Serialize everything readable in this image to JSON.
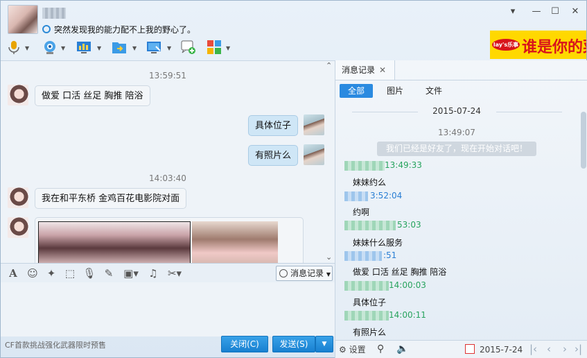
{
  "header": {
    "signature": "突然发现我的能力配不上我的野心了。",
    "window_controls": [
      "▾",
      "—",
      "☐",
      "✕"
    ],
    "ad": {
      "logo": "lay's乐事",
      "text": "谁是你的菜"
    },
    "toolbar": [
      "microphone-icon",
      "video-camera-icon",
      "screen-share-icon",
      "file-transfer-icon",
      "remote-desktop-icon",
      "add-app-icon",
      "apps-grid-icon"
    ]
  },
  "chat": {
    "messages": [
      {
        "type": "time",
        "text": "13:59:51"
      },
      {
        "type": "her",
        "text": "做爱  口活  丝足  胸推  陪浴"
      },
      {
        "type": "me",
        "text": "具体位子"
      },
      {
        "type": "me",
        "text": "有照片么"
      },
      {
        "type": "time",
        "text": "14:03:40"
      },
      {
        "type": "her",
        "text": "我在和平东桥  金鸡百花电影院对面"
      },
      {
        "type": "her-images",
        "text": ""
      }
    ]
  },
  "input": {
    "toolbar_icons": [
      "font-icon",
      "emoji-icon",
      "shake-icon",
      "screenshot-icon",
      "voice-icon",
      "edit-icon",
      "image-icon",
      "music-icon",
      "scissors-icon"
    ],
    "history_button": "消息记录",
    "footer_ad": "CF首款挑战强化武器限时预售",
    "close_button": "关闭(C)",
    "send_button": "发送(S)"
  },
  "history": {
    "tab_label": "消息记录",
    "filters": [
      "全部",
      "图片",
      "文件"
    ],
    "date": "2015-07-24",
    "first_time": "13:49:07",
    "system_message": "我们已经是好友了，现在开始对话吧！",
    "entries": [
      {
        "time": "13:49:33",
        "color": "g",
        "msg": "妹妹约么"
      },
      {
        "time": "3:52:04",
        "color": "b",
        "msg": "约啊"
      },
      {
        "time": "53:03",
        "color": "g",
        "msg": "妹妹什么服务"
      },
      {
        "time": ":51",
        "color": "b",
        "msg": "做爱  口活  丝足  胸推  陪浴"
      },
      {
        "time": "14:00:03",
        "color": "g",
        "msg": "具体位子"
      },
      {
        "time": "14:00:11",
        "color": "g",
        "msg": "有照片么"
      }
    ],
    "footer": {
      "settings_label": "设置",
      "date_value": "2015-7-24"
    }
  }
}
